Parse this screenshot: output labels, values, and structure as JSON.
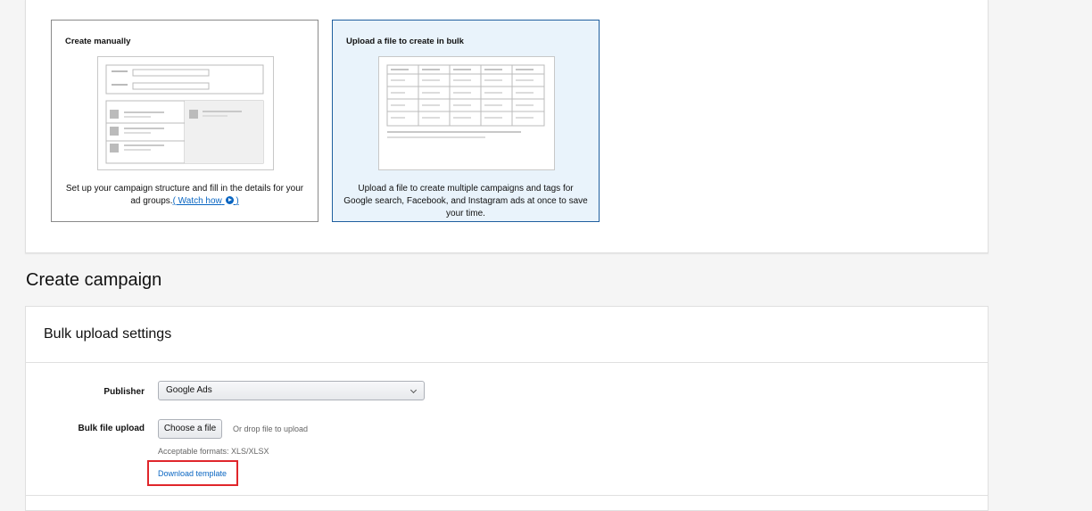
{
  "cards": {
    "manual": {
      "title": "Create manually",
      "desc_prefix": "Set up your campaign structure and fill in the details for your ad groups.",
      "watch_link": "( Watch how",
      "watch_suffix": ")"
    },
    "bulk": {
      "title": "Upload a file to create in bulk",
      "desc": "Upload a file to create multiple campaigns and tags for Google search, Facebook, and Instagram ads at once to save your time."
    }
  },
  "section_heading": "Create campaign",
  "settings": {
    "title": "Bulk upload settings",
    "publisher_label": "Publisher",
    "publisher_value": "Google Ads",
    "bulk_label": "Bulk file upload",
    "choose_file": "Choose a file",
    "drop_text": "Or drop file to upload",
    "formats": "Acceptable formats: XLS/XLSX",
    "download_template": "Download template"
  },
  "colors": {
    "accent_link": "#0a66c2",
    "selected_card_bg": "#e9f3fb",
    "selected_card_border": "#1f5f9f",
    "highlight_box": "#e0262b"
  }
}
